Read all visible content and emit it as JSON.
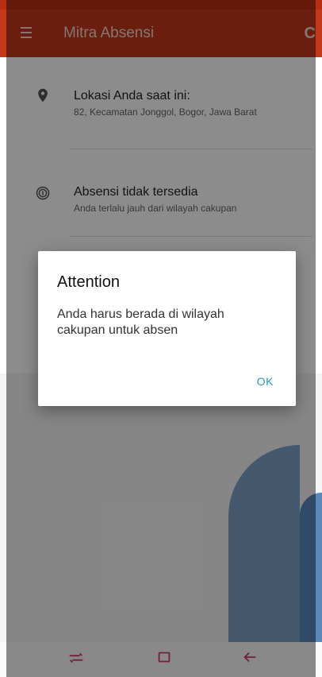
{
  "appbar": {
    "title": "Mitra Absensi",
    "menu_icon": "menu-icon",
    "refresh_icon": "refresh-icon",
    "refresh_glyph": "C"
  },
  "location": {
    "title": "Lokasi Anda saat ini:",
    "address": "82, Kecamatan Jonggol, Bogor, Jawa Barat",
    "icon": "location-pin-icon"
  },
  "attendance": {
    "title": "Absensi tidak tersedia",
    "subtitle": "Anda terlalu jauh dari wilayah cakupan",
    "icon": "fingerprint-icon"
  },
  "dialog": {
    "title": "Attention",
    "message": "Anda harus berada di wilayah cakupan untuk absen",
    "ok_label": "OK"
  },
  "navbar": {
    "recent_icon": "recent-apps-icon",
    "home_icon": "home-icon",
    "back_icon": "back-icon"
  },
  "colors": {
    "appbar": "#c4381a",
    "accent": "#2a9bb0",
    "navbar_icons": "#d33a66"
  }
}
